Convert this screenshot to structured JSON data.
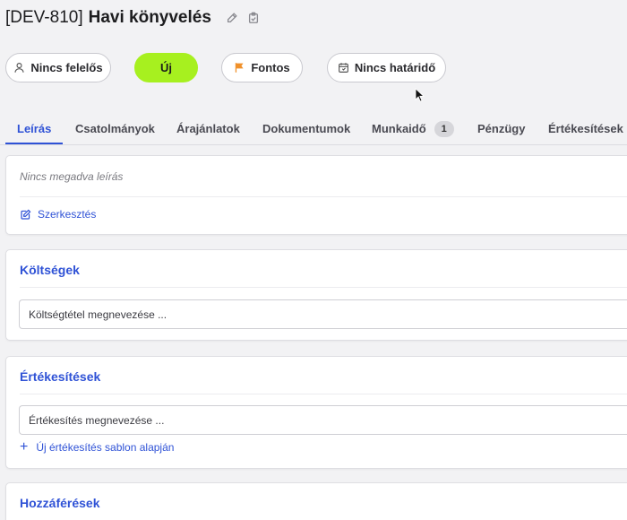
{
  "header": {
    "ticket_id": "[DEV-810]",
    "ticket_title": "Havi könyvelés"
  },
  "pills": {
    "assignee": "Nincs felelős",
    "status": "Új",
    "priority": "Fontos",
    "deadline": "Nincs határidő"
  },
  "colors": {
    "accent": "#2f52d6",
    "status_green": "#a7f01f",
    "priority_flag": "#f0902a"
  },
  "tabs": [
    {
      "label": "Leírás",
      "active": true
    },
    {
      "label": "Csatolmányok"
    },
    {
      "label": "Árajánlatok"
    },
    {
      "label": "Dokumentumok"
    },
    {
      "label": "Munkaidő",
      "badge": "1"
    },
    {
      "label": "Pénzügy"
    },
    {
      "label": "Értékesítések"
    }
  ],
  "description": {
    "empty_text": "Nincs megadva leírás",
    "edit_label": "Szerkesztés"
  },
  "costs": {
    "title": "Költségek",
    "input_placeholder": "Költségtétel megnevezése ..."
  },
  "sales": {
    "title": "Értékesítések",
    "input_placeholder": "Értékesítés megnevezése ...",
    "add_from_template": "Új értékesítés sablon alapján"
  },
  "access": {
    "title": "Hozzáférések"
  }
}
